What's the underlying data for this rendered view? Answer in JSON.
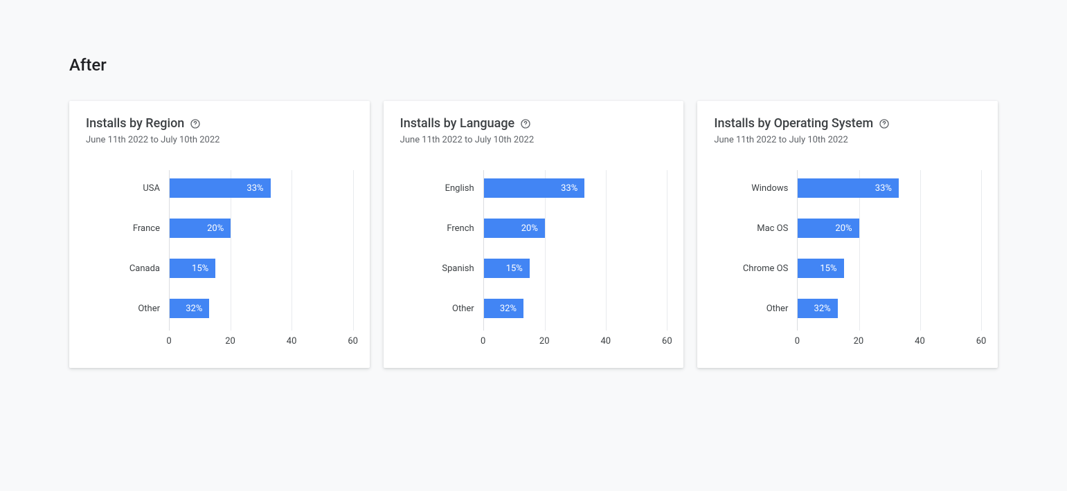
{
  "page_title": "After",
  "date_range": "June 11th 2022 to July 10th 2022",
  "axis": {
    "max": 60,
    "ticks": [
      0,
      20,
      40,
      60
    ]
  },
  "cards": [
    {
      "title": "Installs by Region"
    },
    {
      "title": "Installs by Language"
    },
    {
      "title": "Installs by Operating System"
    }
  ],
  "chart_data": [
    {
      "type": "bar",
      "title": "Installs by Region",
      "categories": [
        "USA",
        "France",
        "Canada",
        "Other"
      ],
      "values": [
        33,
        20,
        15,
        32
      ],
      "value_labels": [
        "33%",
        "20%",
        "15%",
        "32%"
      ],
      "xlim": [
        0,
        60
      ],
      "xticks": [
        0,
        20,
        40,
        60
      ]
    },
    {
      "type": "bar",
      "title": "Installs by Language",
      "categories": [
        "English",
        "French",
        "Spanish",
        "Other"
      ],
      "values": [
        33,
        20,
        15,
        32
      ],
      "value_labels": [
        "33%",
        "20%",
        "15%",
        "32%"
      ],
      "xlim": [
        0,
        60
      ],
      "xticks": [
        0,
        20,
        40,
        60
      ]
    },
    {
      "type": "bar",
      "title": "Installs by Operating System",
      "categories": [
        "Windows",
        "Mac OS",
        "Chrome OS",
        "Other"
      ],
      "values": [
        33,
        20,
        15,
        32
      ],
      "value_labels": [
        "33%",
        "20%",
        "15%",
        "32%"
      ],
      "xlim": [
        0,
        60
      ],
      "xticks": [
        0,
        20,
        40,
        60
      ]
    }
  ]
}
